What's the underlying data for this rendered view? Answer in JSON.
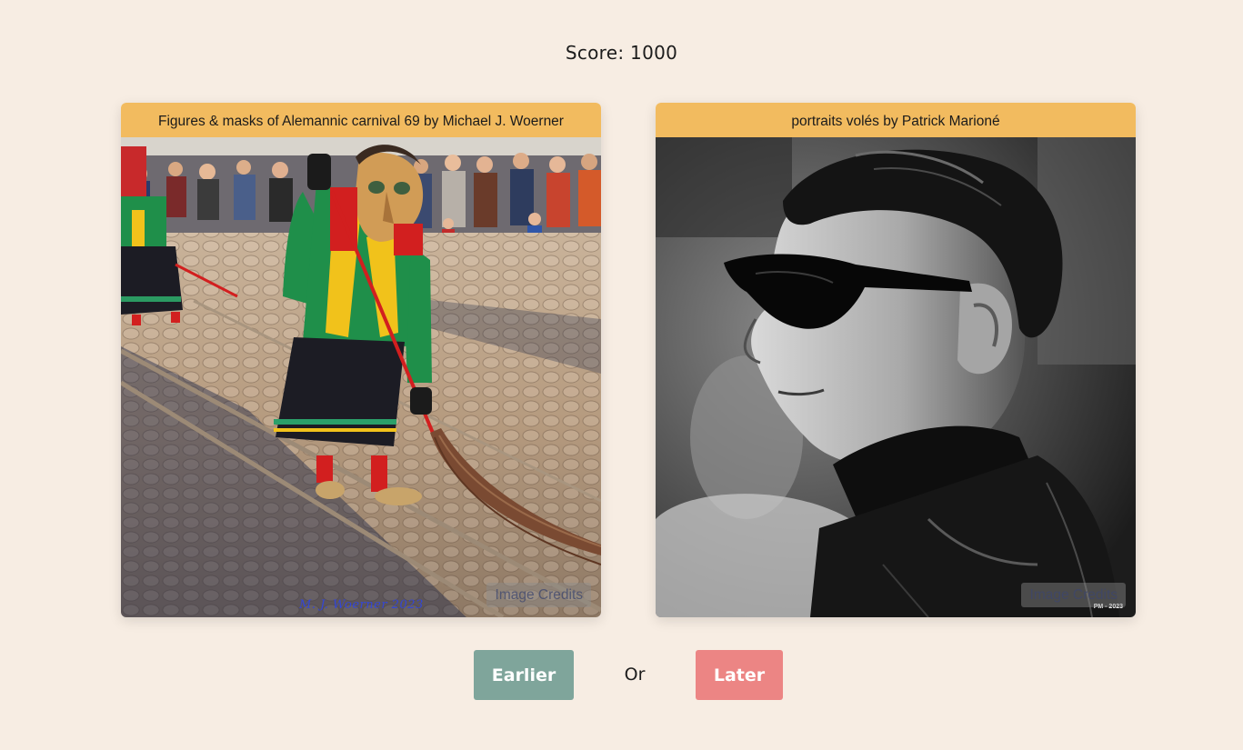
{
  "score": {
    "text": "Score: 1000"
  },
  "cards": [
    {
      "title": "Figures & masks of Alemannic carnival 69 by Michael J. Woerner",
      "credits_label": "Image Credits",
      "watermark": "M. J. Woerner 2023"
    },
    {
      "title": "portraits volés by Patrick Marioné",
      "credits_label": "Image Credits",
      "watermark": "PM - 2023"
    }
  ],
  "actions": {
    "earlier_label": "Earlier",
    "or_label": "Or",
    "later_label": "Later"
  },
  "colors": {
    "background": "#f7ede3",
    "card_header": "#f2bb5f",
    "earlier_button": "#7fa59b",
    "later_button": "#ec8584"
  }
}
